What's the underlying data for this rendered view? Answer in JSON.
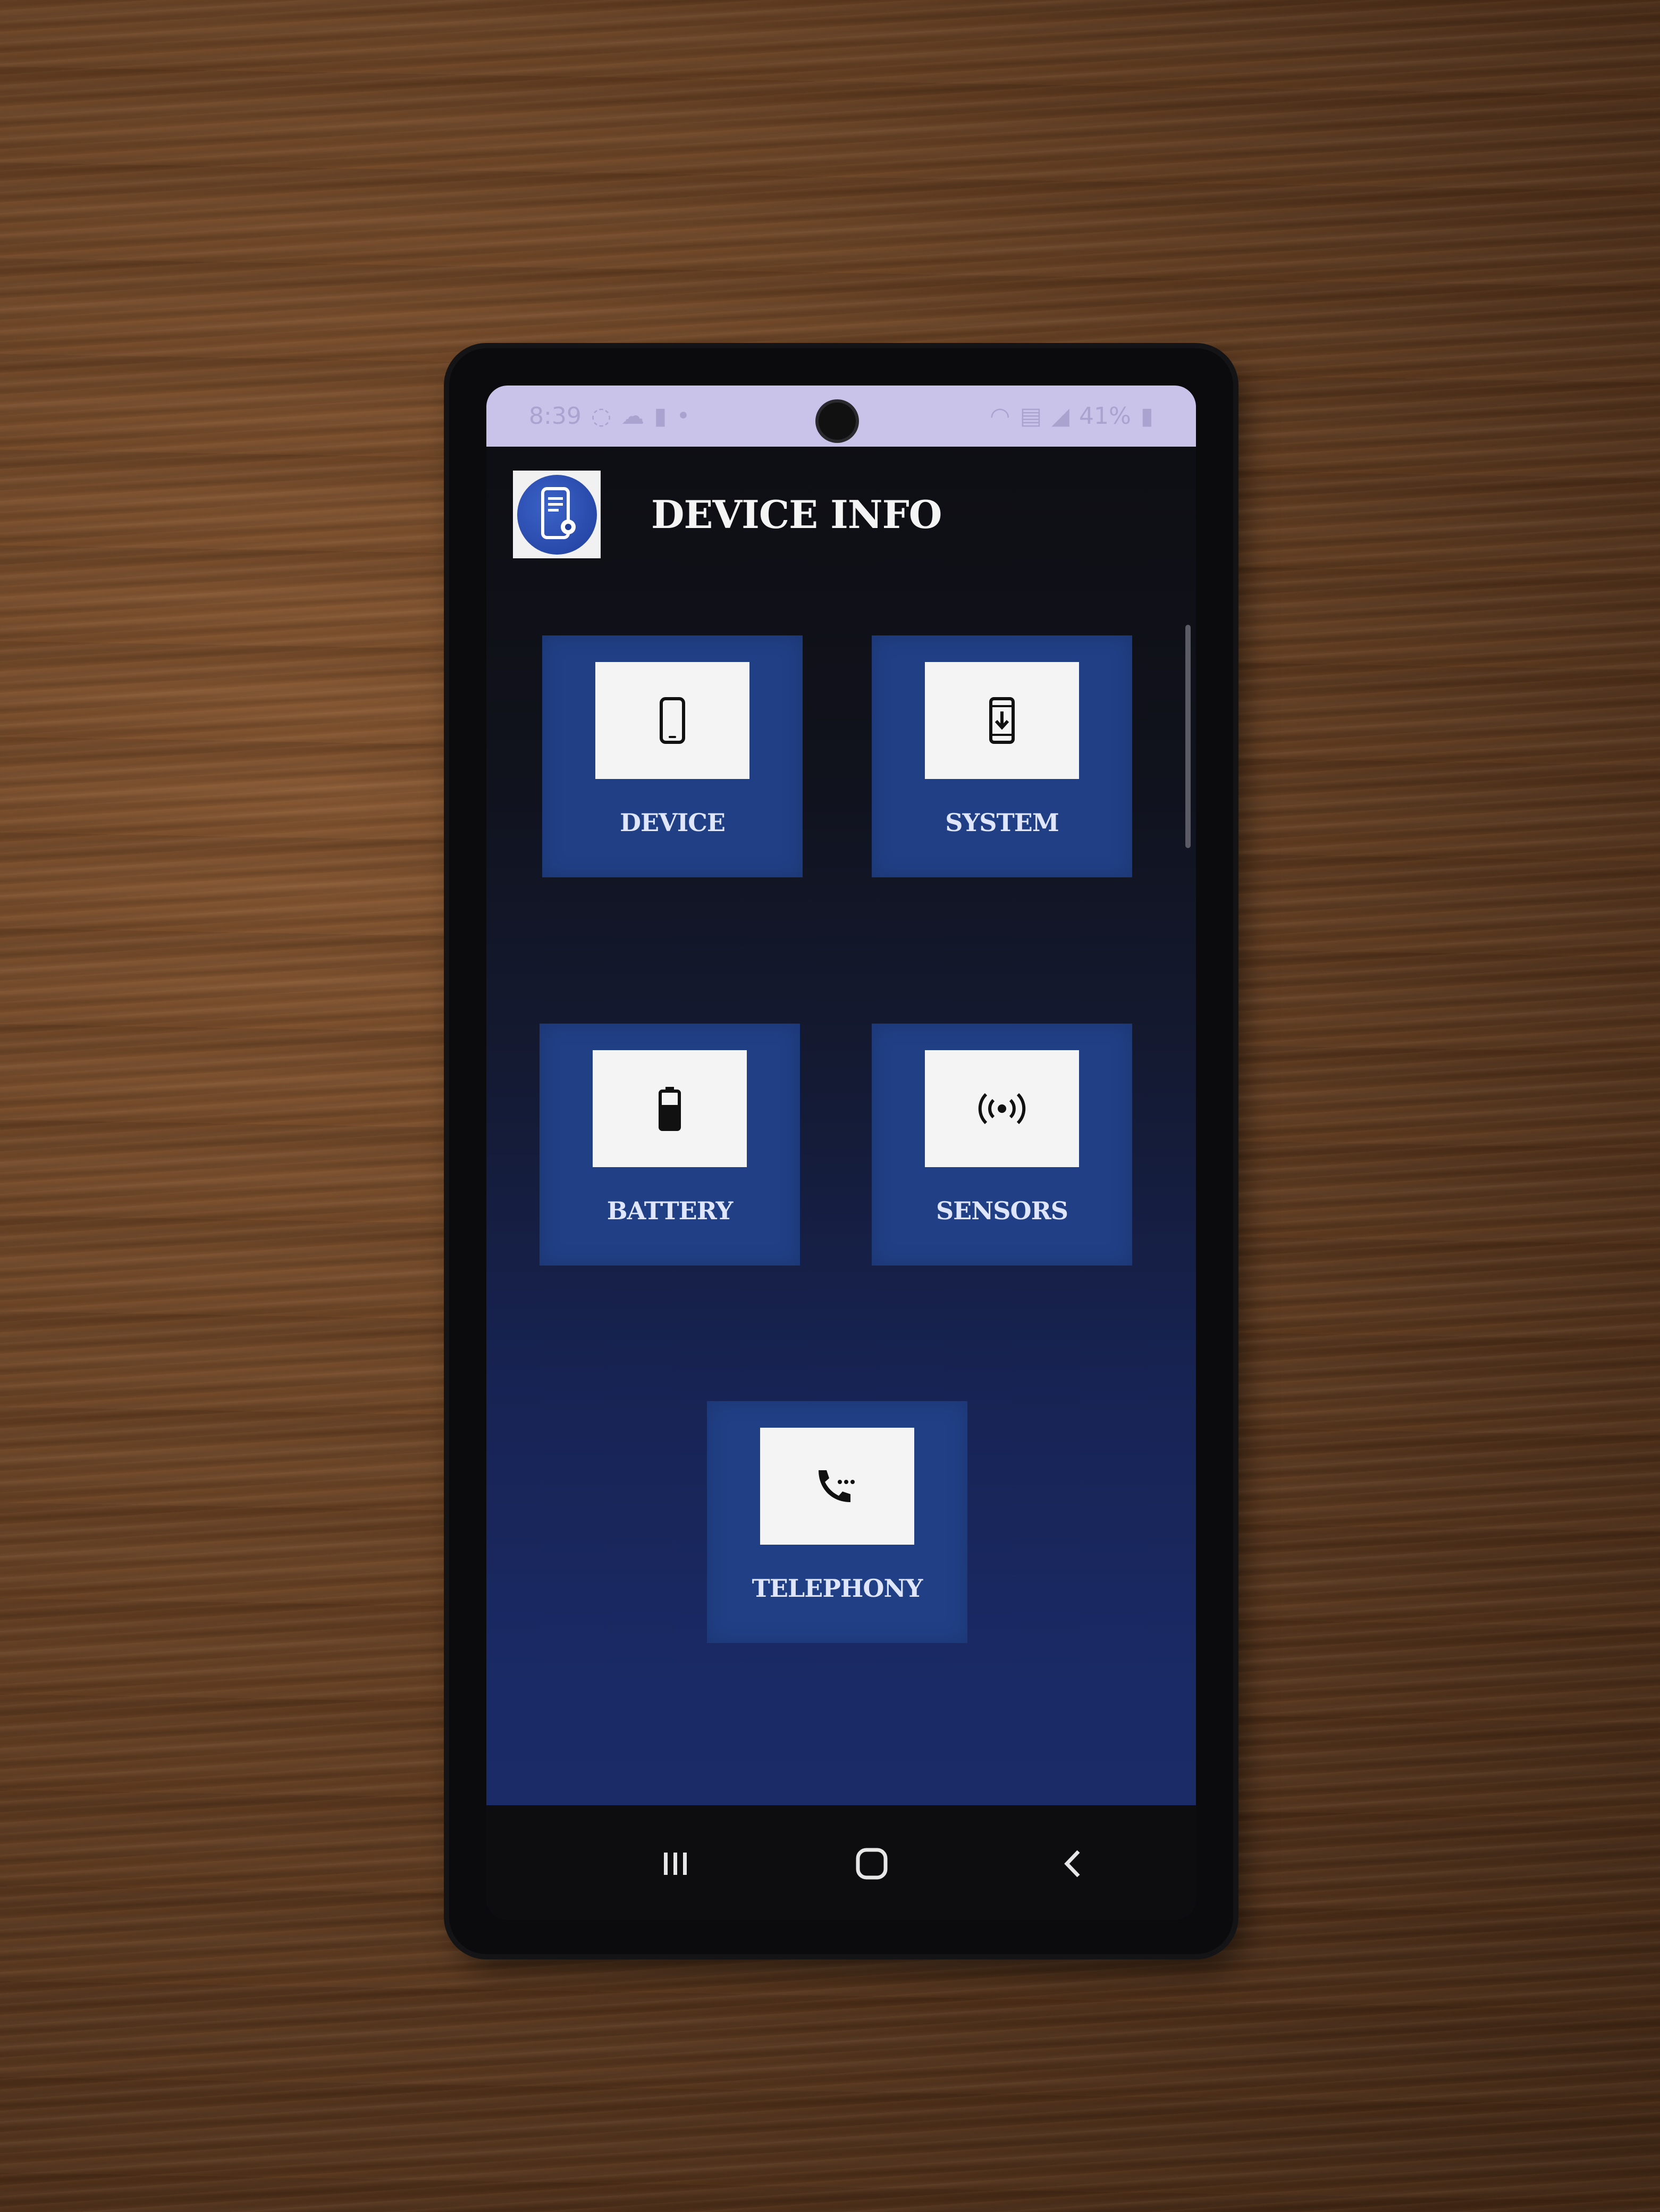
{
  "status_bar": {
    "time": "8:39",
    "battery_text": "41%"
  },
  "app": {
    "title": "DEVICE INFO"
  },
  "tiles": [
    {
      "label": "DEVICE",
      "icon": "smartphone-icon"
    },
    {
      "label": "SYSTEM",
      "icon": "system-update-icon"
    },
    {
      "label": "BATTERY",
      "icon": "battery-icon"
    },
    {
      "label": "SENSORS",
      "icon": "sensors-icon"
    },
    {
      "label": "TELEPHONY",
      "icon": "phone-call-icon"
    }
  ],
  "nav": {
    "recents": "recents-icon",
    "home": "home-icon",
    "back": "back-icon"
  },
  "colors": {
    "tile_bg": "#203f85",
    "icon_box_bg": "#f4f4f4",
    "status_bar_bg": "#c9c3ea",
    "screen_top": "#0e0e12",
    "screen_bottom": "#1c2c6a"
  }
}
